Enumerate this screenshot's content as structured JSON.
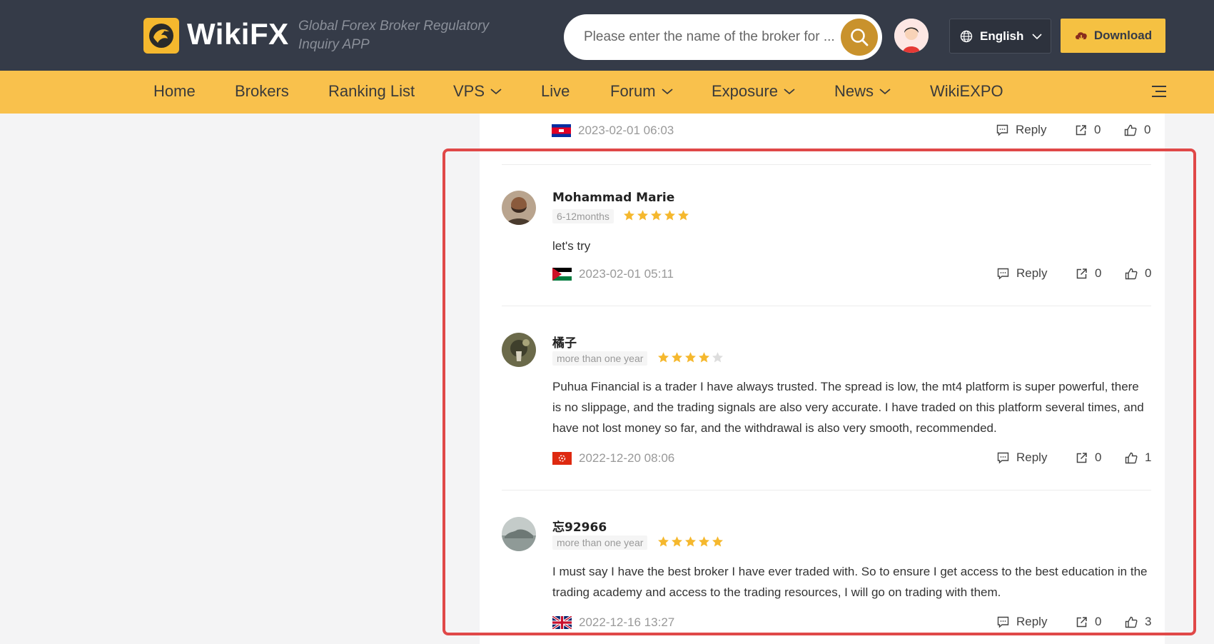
{
  "header": {
    "logo_text": "WikiFX",
    "tagline": "Global Forex Broker Regulatory Inquiry APP",
    "search_placeholder": "Please enter the name of the broker for ...",
    "language": "English",
    "download": "Download",
    "brand_color": "#f5b82e",
    "dark_bg": "#353b48"
  },
  "nav": {
    "items": [
      {
        "label": "Home",
        "dropdown": false
      },
      {
        "label": "Brokers",
        "dropdown": false
      },
      {
        "label": "Ranking List",
        "dropdown": false
      },
      {
        "label": "VPS",
        "dropdown": true
      },
      {
        "label": "Live",
        "dropdown": false
      },
      {
        "label": "Forum",
        "dropdown": true
      },
      {
        "label": "Exposure",
        "dropdown": true
      },
      {
        "label": "News",
        "dropdown": true
      },
      {
        "label": "WikiEXPO",
        "dropdown": false
      }
    ],
    "bg_color": "#f9c14c"
  },
  "previous_review_meta": {
    "date": "2023-02-01 06:03",
    "flag": "cambodia-flag",
    "reply": "Reply",
    "shares": "0",
    "likes": "0"
  },
  "reviews": [
    {
      "name": "Mohammad Marie",
      "tag": "6-12months",
      "rating": 5,
      "text": "let's try",
      "date": "2023-02-01 05:11",
      "flag": "jordan-flag",
      "reply": "Reply",
      "shares": "0",
      "likes": "0"
    },
    {
      "name": "橘子",
      "tag": "more than one year",
      "rating": 4,
      "text": "Puhua Financial is a trader I have always trusted. The spread is low, the mt4 platform is super powerful, there is no slippage, and the trading signals are also very accurate. I have traded on this platform several times, and have not lost money so far, and the withdrawal is also very smooth, recommended.",
      "date": "2022-12-20 08:06",
      "flag": "hong-kong-flag",
      "reply": "Reply",
      "shares": "0",
      "likes": "1"
    },
    {
      "name": "忘92966",
      "tag": "more than one year",
      "rating": 5,
      "text": "I must say I have the best broker I have ever traded with. So to ensure I get access to the best education in the trading academy and access to the trading resources, I will go on trading with them.",
      "date": "2022-12-16 13:27",
      "flag": "uk-flag",
      "reply": "Reply",
      "shares": "0",
      "likes": "3"
    }
  ],
  "colors": {
    "star_filled": "#f5b82e",
    "star_empty": "#dddddd",
    "highlight_border": "#e04848"
  }
}
